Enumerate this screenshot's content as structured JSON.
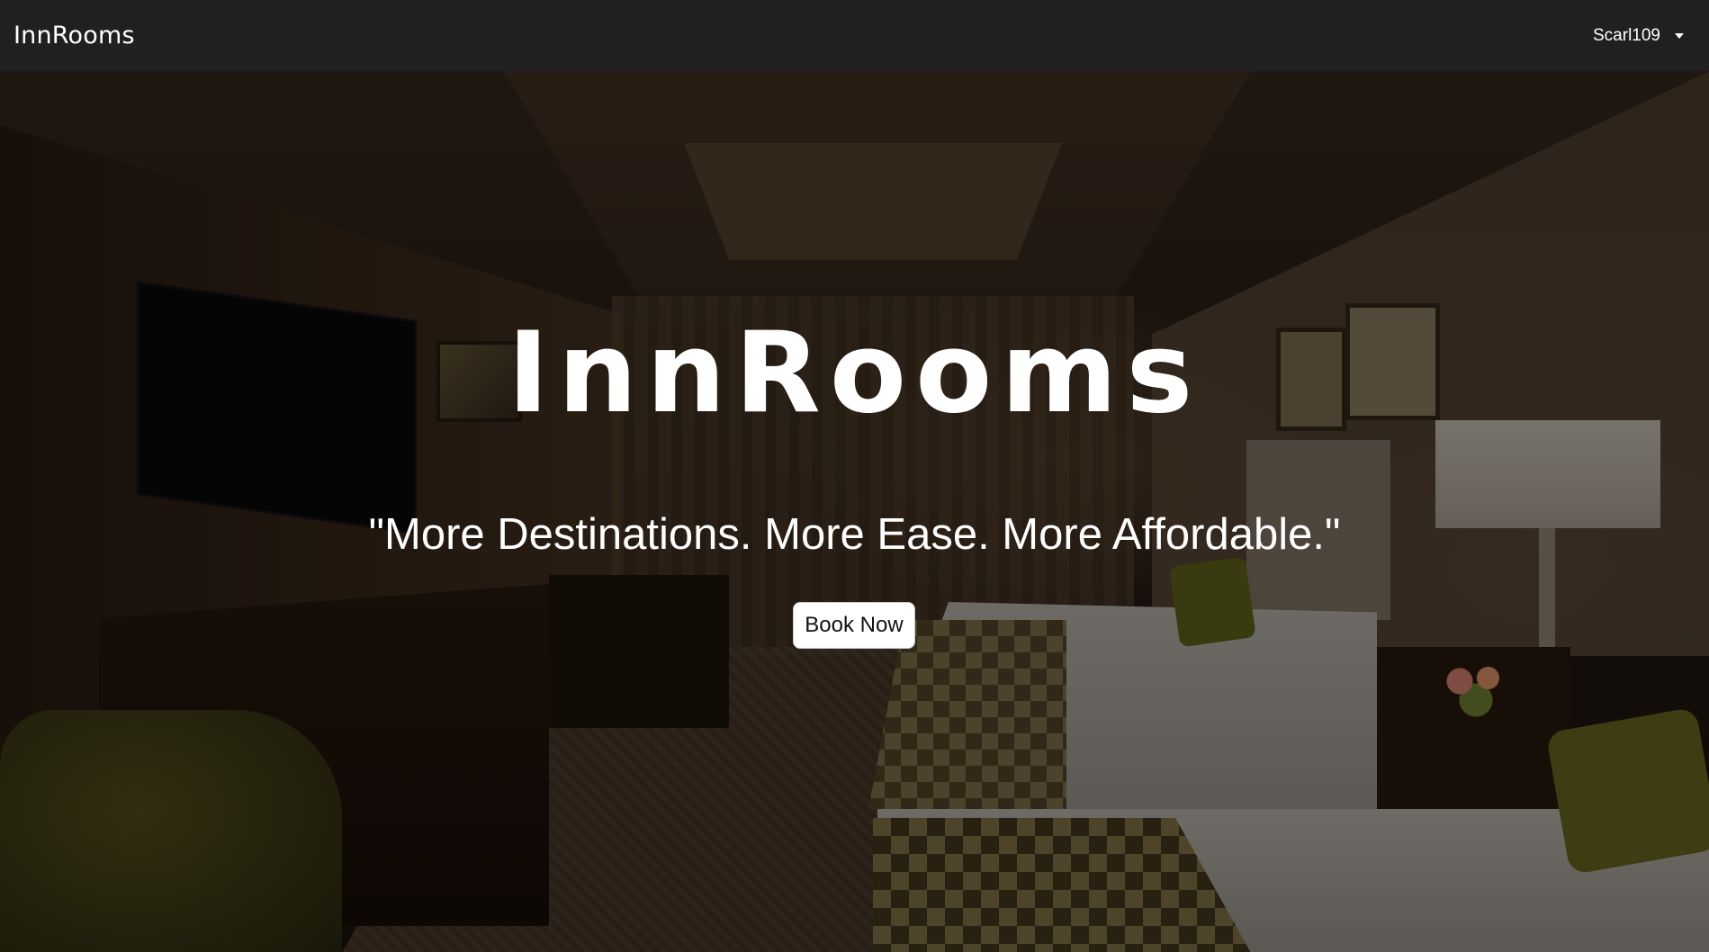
{
  "navbar": {
    "brand": "InnRooms",
    "user": {
      "name": "Scarl109",
      "dropdown_icon": "caret-down-icon"
    }
  },
  "hero": {
    "title": "InnRooms",
    "tagline": "\"More Destinations. More Ease. More Affordable.\"",
    "cta_label": "Book Now",
    "background_image": "hotel-room-photo"
  },
  "colors": {
    "navbar_bg": "#202020",
    "text": "#ffffff",
    "button_bg": "#ffffff",
    "button_text": "#111111"
  }
}
